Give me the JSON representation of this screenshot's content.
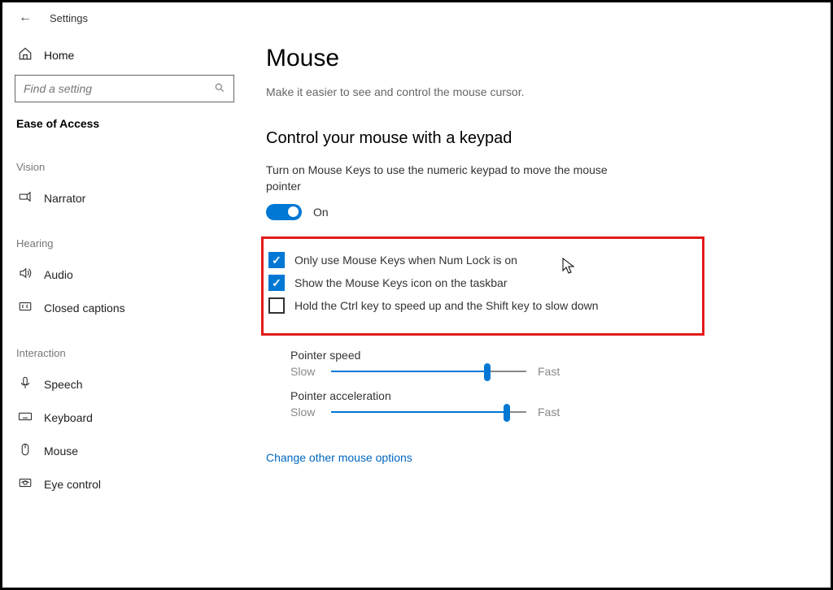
{
  "app_title": "Settings",
  "home_label": "Home",
  "search_placeholder": "Find a setting",
  "category_header": "Ease of Access",
  "groups": {
    "vision": {
      "label": "Vision",
      "items": [
        {
          "label": "Narrator"
        }
      ]
    },
    "hearing": {
      "label": "Hearing",
      "items": [
        {
          "label": "Audio"
        },
        {
          "label": "Closed captions"
        }
      ]
    },
    "interaction": {
      "label": "Interaction",
      "items": [
        {
          "label": "Speech"
        },
        {
          "label": "Keyboard"
        },
        {
          "label": "Mouse"
        },
        {
          "label": "Eye control"
        }
      ]
    }
  },
  "main": {
    "title": "Mouse",
    "subtitle": "Make it easier to see and control the mouse cursor.",
    "section_title": "Control your mouse with a keypad",
    "section_desc": "Turn on Mouse Keys to use the numeric keypad to move the mouse pointer",
    "toggle_state": "On",
    "checkboxes": [
      {
        "label": "Only use Mouse Keys when Num Lock is on",
        "checked": true
      },
      {
        "label": "Show the Mouse Keys icon on the taskbar",
        "checked": true
      },
      {
        "label": "Hold the Ctrl key to speed up and the Shift key to slow down",
        "checked": false
      }
    ],
    "sliders": {
      "speed": {
        "title": "Pointer speed",
        "low": "Slow",
        "high": "Fast",
        "value": 80
      },
      "accel": {
        "title": "Pointer acceleration",
        "low": "Slow",
        "high": "Fast",
        "value": 90
      }
    },
    "link": "Change other mouse options"
  }
}
